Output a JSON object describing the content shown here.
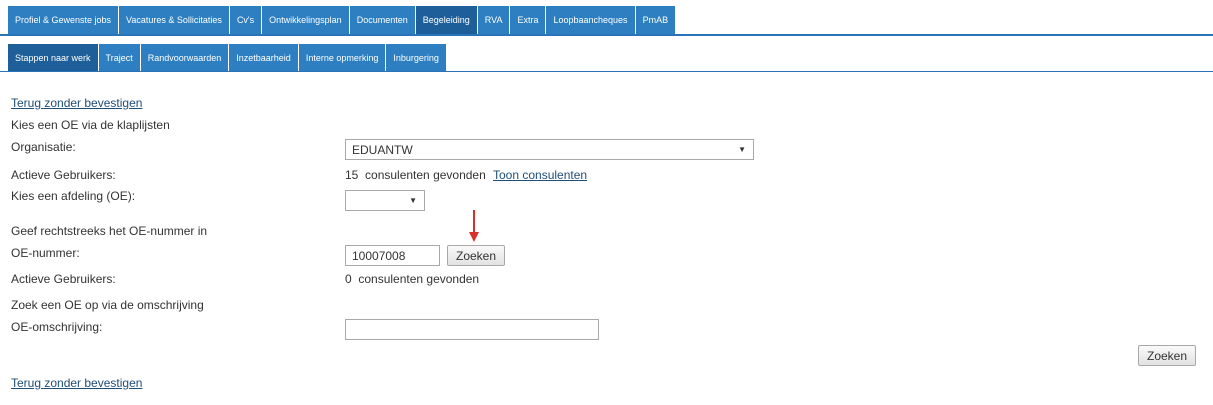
{
  "top_tabs": [
    {
      "label": "Profiel & Gewenste jobs",
      "active": false
    },
    {
      "label": "Vacatures & Sollicitaties",
      "active": false
    },
    {
      "label": "Cv's",
      "active": false
    },
    {
      "label": "Ontwikkelingsplan",
      "active": false
    },
    {
      "label": "Documenten",
      "active": false
    },
    {
      "label": "Begeleiding",
      "active": true
    },
    {
      "label": "RVA",
      "active": false
    },
    {
      "label": "Extra",
      "active": false
    },
    {
      "label": "Loopbaancheques",
      "active": false
    },
    {
      "label": "PmAB",
      "active": false
    }
  ],
  "sub_tabs": [
    {
      "label": "Stappen naar werk",
      "active": true
    },
    {
      "label": "Traject",
      "active": false
    },
    {
      "label": "Randvoorwaarden",
      "active": false
    },
    {
      "label": "Inzetbaarheid",
      "active": false
    },
    {
      "label": "Interne opmerking",
      "active": false
    },
    {
      "label": "Inburgering",
      "active": false
    }
  ],
  "form": {
    "back_link_top": "Terug zonder bevestigen",
    "section1_heading": "Kies een OE via de klaplijsten",
    "organisatie_label": "Organisatie:",
    "organisatie_value": "EDUANTW",
    "actieve1_label": "Actieve Gebruikers:",
    "actieve1_value": "15  consulenten gevonden",
    "toon_link": "Toon consulenten",
    "afdeling_label": "Kies een afdeling (OE):",
    "afdeling_value": "",
    "section2_heading": "Geef rechtstreeks het OE-nummer in",
    "oe_nummer_label": "OE-nummer:",
    "oe_nummer_value": "10007008",
    "zoeken1_label": "Zoeken",
    "actieve2_label": "Actieve Gebruikers:",
    "actieve2_value": "0  consulenten gevonden",
    "section3_heading": "Zoek een OE op via de omschrijving",
    "omschrijving_label": "OE-omschrijving:",
    "omschrijving_value": "",
    "zoeken2_label": "Zoeken",
    "back_link_bottom": "Terug zonder bevestigen"
  },
  "colors": {
    "tab": "#2d7fc1",
    "tab_active": "#1f5f99",
    "annotation_arrow": "#d9302c"
  },
  "icons": {
    "dropdown": "triangle-down",
    "annotation": "red-down-arrow"
  }
}
